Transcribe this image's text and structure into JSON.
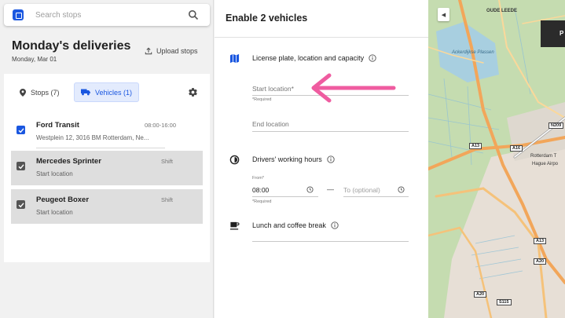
{
  "search": {
    "placeholder": "Search stops"
  },
  "header": {
    "title": "Monday's deliveries",
    "date": "Monday, Mar 01",
    "upload_label": "Upload stops"
  },
  "tabs": [
    {
      "label": "Stops (7)",
      "active": false
    },
    {
      "label": "Vehicles (1)",
      "active": true
    }
  ],
  "vehicles": [
    {
      "name": "Ford Transit",
      "time": "08:00-16:00",
      "address": "Westplein 12, 3016 BM Rotterdam, Ne...",
      "checked": true,
      "selected": true
    },
    {
      "name": "Mercedes Sprinter",
      "time": "Shift",
      "address": "Start location",
      "checked": true,
      "selected": false
    },
    {
      "name": "Peugeot Boxer",
      "time": "Shift",
      "address": "Start location",
      "checked": true,
      "selected": false
    }
  ],
  "form": {
    "title": "Enable 2 vehicles",
    "section_location": "License plate, location and capacity",
    "start_location_placeholder": "Start location*",
    "required_text": "*Required",
    "end_location_placeholder": "End location",
    "section_hours": "Drivers' working hours",
    "from_label": "From*",
    "from_value": "08:00",
    "dash": "—",
    "to_placeholder": "To (optional)",
    "hours_required": "*Required",
    "section_break": "Lunch and coffee break"
  },
  "map": {
    "labels": {
      "oude_leede": "OUDE LEEDE",
      "ackerdijkse": "Ackerdijkse Plassen",
      "rotterdam": "Rotterdam T",
      "hague": "Hague Airpo",
      "p_button": "P"
    },
    "roads": [
      "A13",
      "A16",
      "N209",
      "A13",
      "A20",
      "A20",
      "S115"
    ]
  },
  "colors": {
    "accent": "#1a57e0",
    "arrow": "#ef5ca0",
    "map_bg": "#c5dcb0"
  }
}
